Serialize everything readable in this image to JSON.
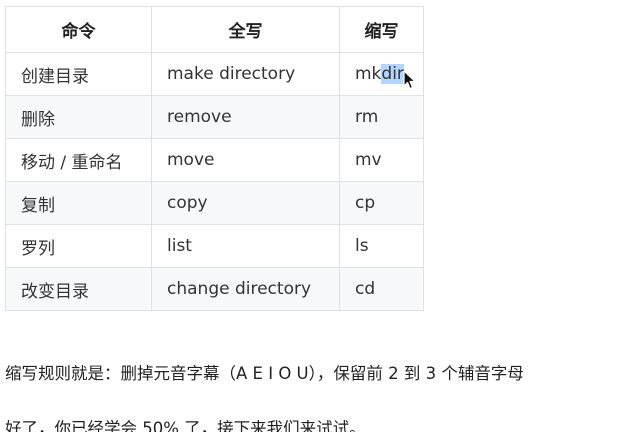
{
  "table": {
    "headers": [
      "命令",
      "全写",
      "缩写"
    ],
    "rows": [
      {
        "command": "创建目录",
        "full": "make directory",
        "abbr_plain": "mk",
        "abbr_selected": "dir"
      },
      {
        "command": "删除",
        "full": "remove",
        "abbr_plain": "rm",
        "abbr_selected": ""
      },
      {
        "command": "移动 / 重命名",
        "full": "move",
        "abbr_plain": "mv",
        "abbr_selected": ""
      },
      {
        "command": "复制",
        "full": "copy",
        "abbr_plain": "cp",
        "abbr_selected": ""
      },
      {
        "command": "罗列",
        "full": "list",
        "abbr_plain": "ls",
        "abbr_selected": ""
      },
      {
        "command": "改变目录",
        "full": "change directory",
        "abbr_plain": "cd",
        "abbr_selected": ""
      }
    ]
  },
  "paragraphs": {
    "rule": "缩写规则就是：删掉元音字幕（A E I O U），保留前 2 到 3 个辅音字母",
    "progress": "好了，你已经学会 50% 了，接下来我们来试试。"
  },
  "cursor_icon": "mouse-pointer-icon",
  "colors": {
    "border": "#dfe2e5",
    "stripe": "#f6f8fa",
    "selection": "#b4d5fe"
  }
}
